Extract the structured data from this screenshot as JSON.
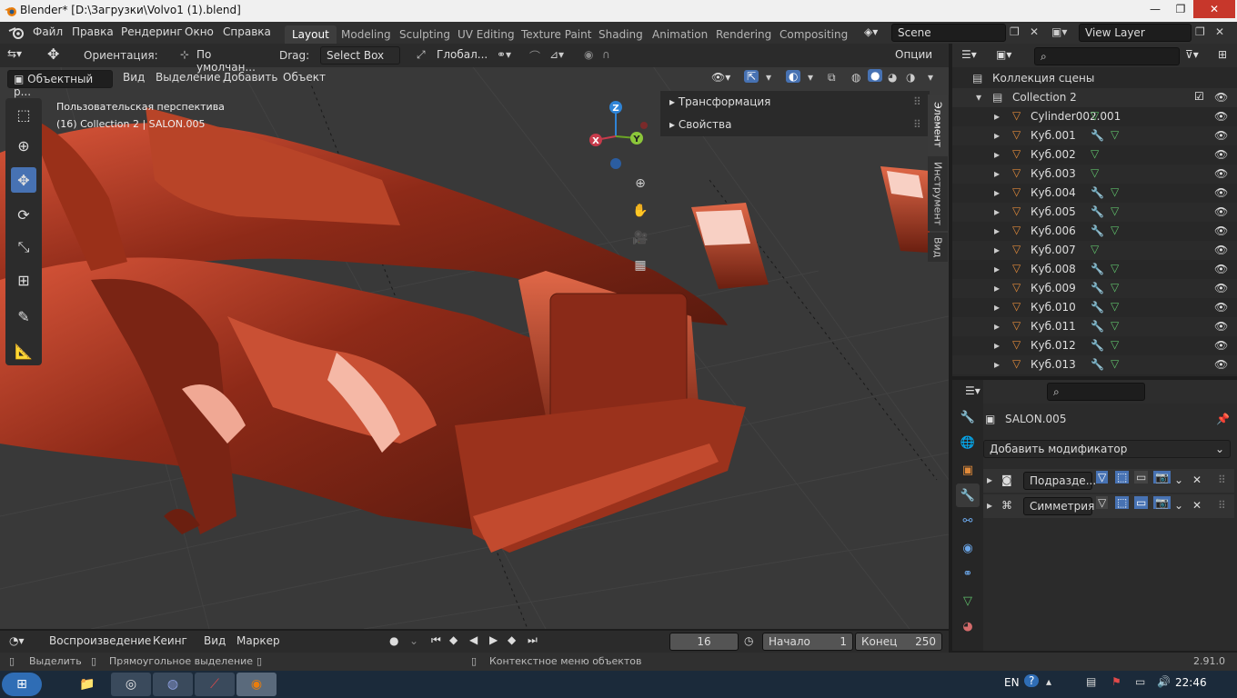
{
  "window": {
    "title": "Blender* [D:\\Загрузки\\Volvo1 (1).blend]"
  },
  "menu": {
    "file": "Файл",
    "edit": "Правка",
    "render": "Рендеринг",
    "window": "Окно",
    "help": "Справка"
  },
  "workspaces": [
    "Layout",
    "Modeling",
    "Sculpting",
    "UV Editing",
    "Texture Paint",
    "Shading",
    "Animation",
    "Rendering",
    "Compositing"
  ],
  "scene": {
    "label": "Scene",
    "view_layer": "View Layer"
  },
  "tool_header": {
    "orientation_label": "Ориентация:",
    "orientation_value": "По умолчан...",
    "drag_label": "Drag:",
    "drag_value": "Select Box",
    "transform_space": "Глобал...",
    "options": "Опции"
  },
  "view_header": {
    "mode": "Объектный р...",
    "view": "Вид",
    "select": "Выделение",
    "add": "Добавить",
    "object": "Объект"
  },
  "viewport": {
    "perspective_text": "Пользовательская перспектива",
    "collection_text": "(16) Collection 2 | SALON.005",
    "axis_x": "X",
    "axis_y": "Y",
    "axis_z": "Z"
  },
  "npanel": {
    "transform": "Трансформация",
    "properties": "Свойства",
    "tab_item": "Элемент",
    "tab_tool": "Инструмент",
    "tab_view": "Вид"
  },
  "outliner": {
    "scene_collection": "Коллекция сцены",
    "collection": "Collection 2",
    "items": [
      {
        "name": "Cylinder002.001",
        "wrench": false
      },
      {
        "name": "Куб.001",
        "wrench": true
      },
      {
        "name": "Куб.002",
        "wrench": false
      },
      {
        "name": "Куб.003",
        "wrench": false
      },
      {
        "name": "Куб.004",
        "wrench": true
      },
      {
        "name": "Куб.005",
        "wrench": true
      },
      {
        "name": "Куб.006",
        "wrench": true
      },
      {
        "name": "Куб.007",
        "wrench": false
      },
      {
        "name": "Куб.008",
        "wrench": true
      },
      {
        "name": "Куб.009",
        "wrench": true
      },
      {
        "name": "Куб.010",
        "wrench": true
      },
      {
        "name": "Куб.011",
        "wrench": true
      },
      {
        "name": "Куб.012",
        "wrench": true
      },
      {
        "name": "Куб.013",
        "wrench": true
      }
    ]
  },
  "properties": {
    "object_name": "SALON.005",
    "add_modifier": "Добавить модификатор",
    "modifiers": [
      {
        "name": "Подразде..."
      },
      {
        "name": "Симметрия"
      }
    ]
  },
  "timeline": {
    "playback": "Воспроизведение",
    "keying": "Кеинг",
    "view": "Вид",
    "marker": "Маркер",
    "current_frame": "16",
    "start_label": "Начало",
    "start": "1",
    "end_label": "Конец",
    "end": "250"
  },
  "statusbar": {
    "select": "Выделить",
    "box_select": "Прямоугольное выделение",
    "context_menu": "Контекстное меню объектов",
    "version": "2.91.0"
  },
  "taskbar": {
    "lang": "EN",
    "clock": "22:46"
  },
  "colors": {
    "accent": "#4772b3",
    "car_body": "#b03a22",
    "viewport_bg": "#393939",
    "panel_bg": "#2b2b2b"
  }
}
